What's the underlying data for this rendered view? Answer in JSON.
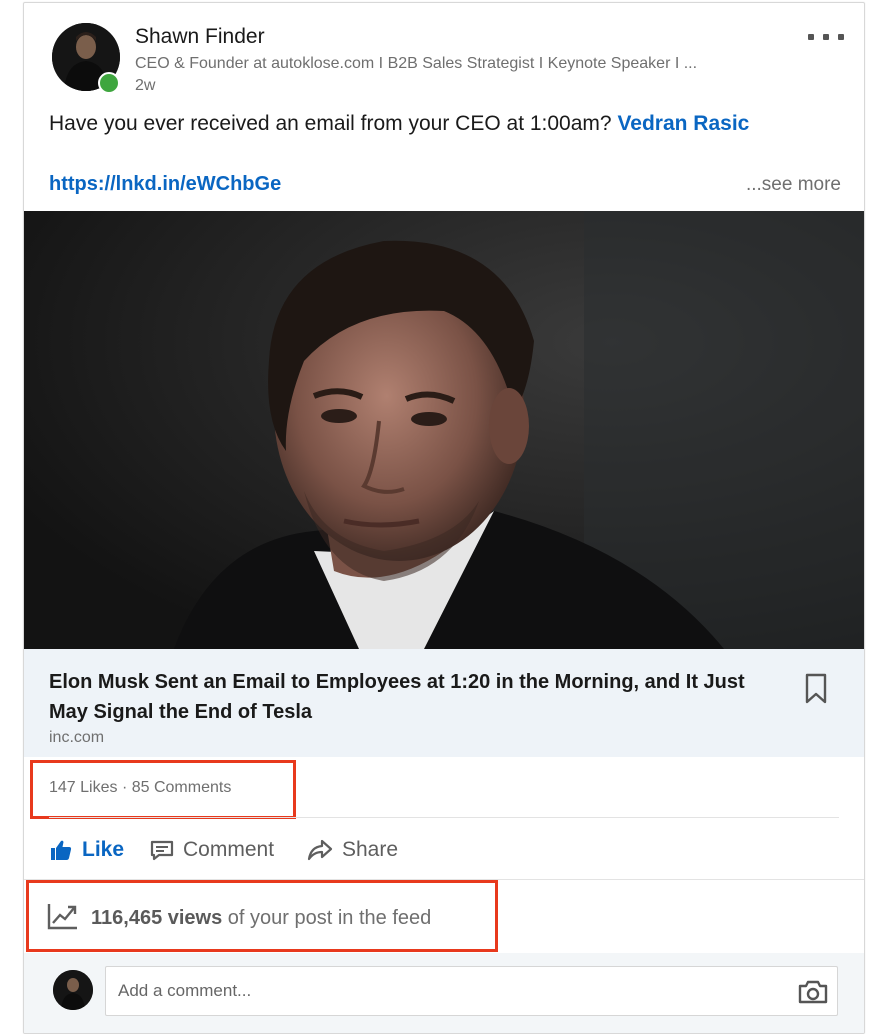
{
  "post": {
    "author": {
      "name": "Shawn Finder",
      "headline": "CEO & Founder at autoklose.com I B2B Sales Strategist I Keynote Speaker I ...",
      "time": "2w"
    },
    "text": "Have you ever received an email from your CEO at 1:00am?",
    "mention": "Vedran Rasic",
    "link": "https://lnkd.in/eWChbGe",
    "see_more": "...see more"
  },
  "article": {
    "title": "Elon Musk Sent an Email to Employees at 1:20 in the Morning, and It Just May Signal the End of Tesla",
    "source": "inc.com"
  },
  "social": {
    "likes": "147 Likes",
    "separator": " · ",
    "comments": "85 Comments"
  },
  "actions": {
    "like": "Like",
    "comment": "Comment",
    "share": "Share"
  },
  "analytics": {
    "views": "116,465 views",
    "suffix": " of your post in the feed"
  },
  "comment_box": {
    "placeholder": "Add a comment..."
  },
  "colors": {
    "accent": "#0a66c2",
    "highlight_box": "#e8391d",
    "presence": "#3fa63f"
  },
  "icons": [
    "more-icon",
    "bookmark-icon",
    "like-icon",
    "comment-icon",
    "share-icon",
    "analytics-icon",
    "camera-icon"
  ]
}
